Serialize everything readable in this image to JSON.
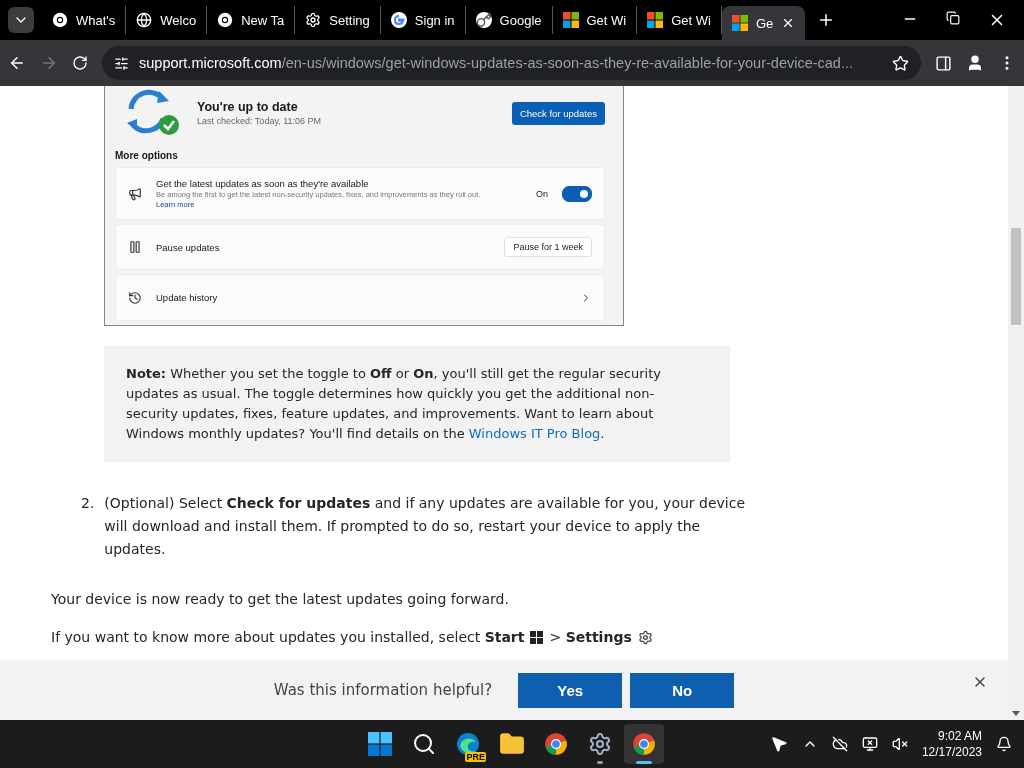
{
  "tabs": [
    {
      "kind": "chrome",
      "title": "What's",
      "selected": false
    },
    {
      "kind": "globe",
      "title": "Welco",
      "selected": false
    },
    {
      "kind": "chrome",
      "title": "New Ta",
      "selected": false
    },
    {
      "kind": "gear",
      "title": "Setting",
      "selected": false
    },
    {
      "kind": "google",
      "title": "Sign in",
      "selected": false
    },
    {
      "kind": "key",
      "title": "Google",
      "selected": false
    },
    {
      "kind": "ms",
      "title": "Get Wi",
      "selected": false
    },
    {
      "kind": "ms",
      "title": "Get Wi",
      "selected": false
    },
    {
      "kind": "ms",
      "title": "Ge",
      "selected": true
    }
  ],
  "address": {
    "host": "support.microsoft.com",
    "path": "/en-us/windows/get-windows-updates-as-soon-as-they-re-available-for-your-device-cad..."
  },
  "settings_image": {
    "title": "You're up to date",
    "last_checked": "Last checked: Today, 11:06 PM",
    "check_button": "Check for updates",
    "more_options": "More options",
    "options": [
      {
        "kind": "toggle",
        "title": "Get the latest updates as soon as they're available",
        "description": "Be among the first to get the latest non-security updates, fixes, and improvements as they roll out.",
        "link": "Learn more",
        "state_label": "On",
        "on": true
      },
      {
        "kind": "button",
        "title": "Pause updates",
        "button": "Pause for 1 week"
      },
      {
        "kind": "link",
        "title": "Update history"
      }
    ]
  },
  "note": {
    "text": "**Note:** Whether you set the toggle to **Off** or **On**, you'll still get the regular security updates as usual. The toggle determines how quickly you get the additional non-security updates, fixes, feature updates, and improvements. Want to learn about Windows monthly updates? You'll find details on the",
    "link": "Windows IT Pro Blog",
    "end": "."
  },
  "step": {
    "number": "2.",
    "text": "(Optional) Select **Check for updates** and if any updates are available for you, your device will download and install them. If prompted to do so, restart your device to apply the updates."
  },
  "paragraph": "Your device is now ready to get the latest updates going forward.",
  "last_line": {
    "before": "If you want to know more about updates you installed, select **Start**",
    "after": "> **Settings**"
  },
  "feedback": {
    "question": "Was this information helpful?",
    "yes": "Yes",
    "no": "No"
  },
  "taskbar": {
    "apps": [
      {
        "kind": "windows",
        "running": false,
        "active": false
      },
      {
        "kind": "search",
        "running": false,
        "active": false
      },
      {
        "kind": "edge",
        "badge": "PRE",
        "running": false,
        "active": false
      },
      {
        "kind": "folder",
        "running": false,
        "active": false
      },
      {
        "kind": "chrome",
        "running": false,
        "active": false
      },
      {
        "kind": "gear",
        "running": true,
        "active": false
      },
      {
        "kind": "chrome",
        "running": true,
        "active": true
      }
    ],
    "time": "9:02 AM",
    "date": "12/17/2023"
  }
}
